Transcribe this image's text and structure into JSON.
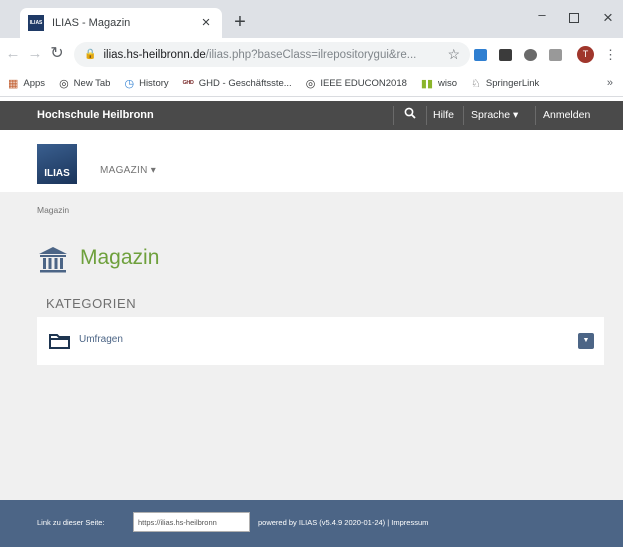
{
  "browser": {
    "tab": {
      "title": "ILIAS - Magazin",
      "favicon_text": "ILIAS"
    },
    "url": {
      "domain": "ilias.hs-heilbronn.de",
      "path": "/ilias.php?baseClass=ilrepositorygui&re..."
    },
    "profile_initial": "T",
    "bookmarks": [
      {
        "label": "Apps",
        "icon": "apps-grid-icon"
      },
      {
        "label": "New Tab",
        "icon": "globe-icon"
      },
      {
        "label": "History",
        "icon": "history-icon"
      },
      {
        "label": "GHD - Geschäftsste...",
        "icon": "ghd-icon"
      },
      {
        "label": "IEEE EDUCON2018",
        "icon": "globe-icon"
      },
      {
        "label": "wiso",
        "icon": "wiso-icon"
      },
      {
        "label": "SpringerLink",
        "icon": "springer-icon"
      }
    ]
  },
  "topbar": {
    "title": "Hochschule Heilbronn",
    "help": "Hilfe",
    "language": "Sprache ▾",
    "login": "Anmelden"
  },
  "header": {
    "logo_text": "ILIAS",
    "main_menu": "MAGAZIN ▾"
  },
  "content": {
    "breadcrumb": "Magazin",
    "page_title": "Magazin",
    "section_title": "KATEGORIEN",
    "items": [
      {
        "label": "Umfragen"
      }
    ]
  },
  "footer": {
    "link_label": "Link zu dieser Seite:",
    "link_value": "https://ilias.hs-heilbronn",
    "powered": "powered by ILIAS (v5.4.9 2020-01-24) | Impressum"
  },
  "colors": {
    "topbar": "#4a4a4a",
    "content_bg": "#f0f0f0",
    "title_green": "#6ea03c",
    "link_blue": "#4c6586",
    "footer": "#4c6586"
  }
}
